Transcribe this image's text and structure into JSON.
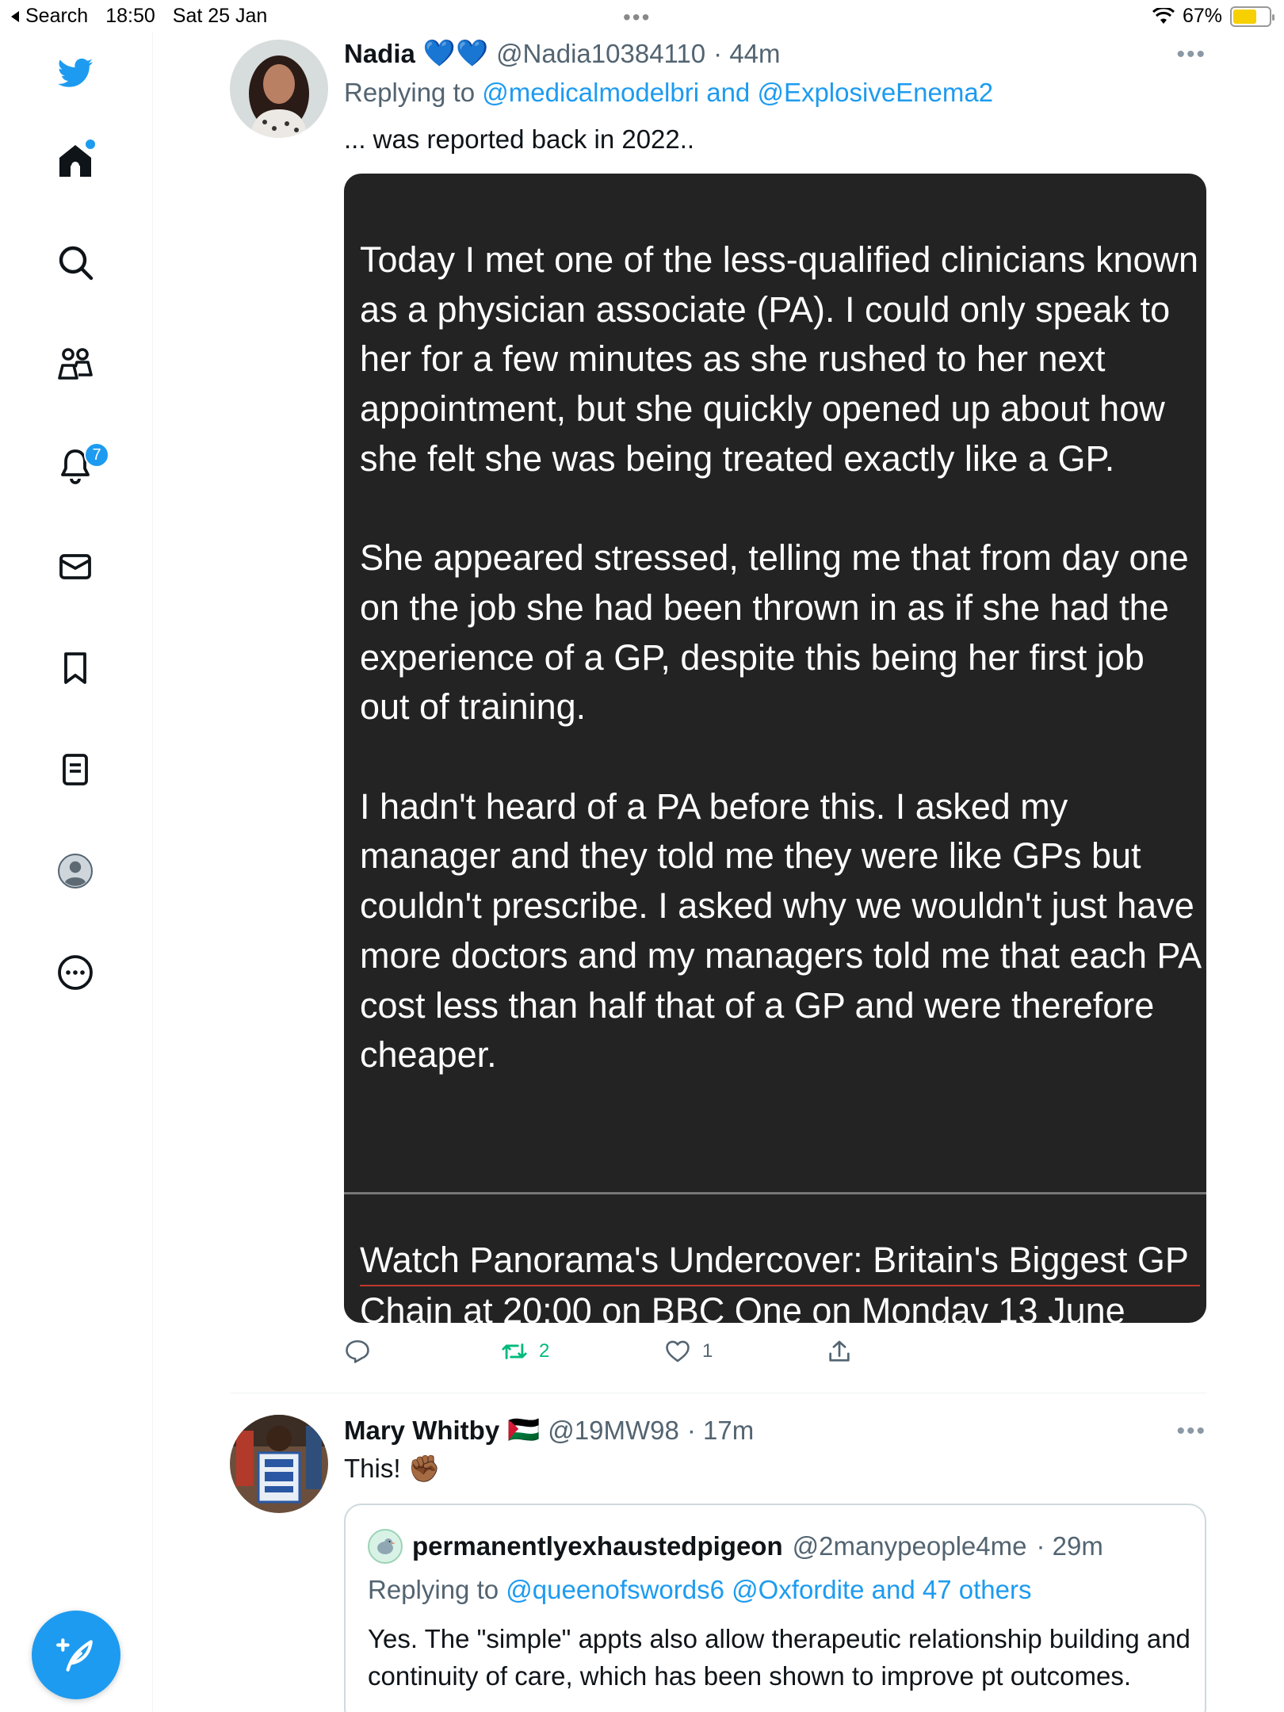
{
  "status_bar": {
    "back_label": "Search",
    "time": "18:50",
    "date": "Sat 25 Jan",
    "multitask_dots": "•••",
    "battery_percent": "67%",
    "battery_level": 0.67
  },
  "sidebar": {
    "items": [
      {
        "name": "twitter-logo"
      },
      {
        "name": "home",
        "has_dot": true
      },
      {
        "name": "explore"
      },
      {
        "name": "communities"
      },
      {
        "name": "notifications",
        "badge": "7"
      },
      {
        "name": "messages"
      },
      {
        "name": "bookmarks"
      },
      {
        "name": "lists"
      },
      {
        "name": "profile"
      },
      {
        "name": "more"
      }
    ],
    "compose_icon": "feather-plus-icon"
  },
  "tweets": [
    {
      "name": "Nadia",
      "emoji": "💙💙",
      "handle": "@Nadia10384110",
      "time": "· 44m",
      "more": "•••",
      "replying_prefix": "Replying to",
      "replying_to": "@medicalmodelbri and @ExplosiveEnema2",
      "text": "... was reported back in 2022..",
      "media": {
        "paragraphs": [
          "Today I met one of the less-qualified clinicians known as a physician associate (PA). I could only speak to her for a few minutes as she rushed to her next appointment, but she quickly opened up about how she felt she was being treated exactly like a GP.",
          "She appeared stressed, telling me that from day one on the job she had been thrown in as if she had the experience of a GP, despite this being her first job out of training.",
          "I hadn't heard of a PA before this. I asked my manager and they told me they were like GPs but couldn't prescribe. I asked why we wouldn't just have more doctors and my managers told me that each PA cost less than half that of a GP and were therefore cheaper."
        ],
        "footer_line1": "Watch Panorama's Undercover: Britain's Biggest GP",
        "footer_line2": "Chain at 20:00 on BBC One on Monday 13 June"
      },
      "actions": {
        "reply_count": "",
        "retweet_count": "2",
        "like_count": "1"
      }
    },
    {
      "name": "Mary Whitby",
      "flag": "🇵🇸",
      "handle": "@19MW98",
      "time": "· 17m",
      "more": "•••",
      "text": "This!",
      "text_emoji": "✊🏾",
      "quote": {
        "name": "permanentlyexhaustedpigeon",
        "handle": "@2manypeople4me",
        "time": "· 29m",
        "replying_prefix": "Replying to",
        "replying_to": "@queenofswords6 @Oxfordite and 47 others",
        "text": "Yes. The \"simple\" appts also allow therapeutic relationship building and continuity of care, which has been shown to improve pt outcomes."
      }
    }
  ],
  "colors": {
    "accent": "#1d9bf0",
    "retweet_green": "#00ba7c",
    "media_bg": "#232323",
    "text": "#0f1419",
    "muted": "#536471"
  }
}
